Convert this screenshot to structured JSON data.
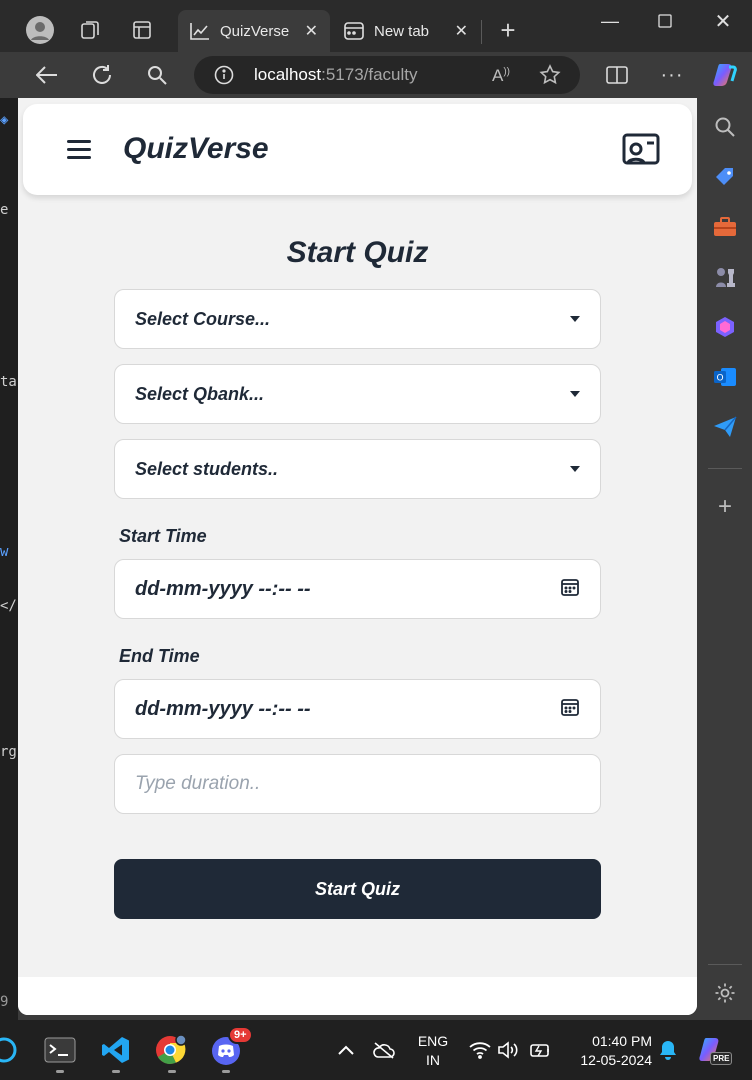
{
  "browser": {
    "tabs": [
      {
        "label": "QuizVerse",
        "active": true
      },
      {
        "label": "New tab",
        "active": false
      }
    ],
    "address": {
      "host": "localhost",
      "path": ":5173/faculty"
    }
  },
  "app": {
    "brand": "QuizVerse"
  },
  "form": {
    "title": "Start Quiz",
    "course_select": "Select Course...",
    "qbank_select": "Select Qbank...",
    "students_select": "Select students..",
    "start_time_label": "Start Time",
    "start_time_value": "dd-mm-yyyy --:-- --",
    "end_time_label": "End Time",
    "end_time_value": "dd-mm-yyyy --:-- --",
    "duration_placeholder": "Type duration..",
    "submit_label": "Start Quiz"
  },
  "taskbar": {
    "lang_line1": "ENG",
    "lang_line2": "IN",
    "time": "01:40 PM",
    "date": "12-05-2024",
    "discord_badge": "9+",
    "copilot_badge": "PRE"
  },
  "colors": {
    "primary": "#1f2937",
    "page_bg": "#f2f2f2",
    "chrome_bg": "#2b2b2b"
  }
}
